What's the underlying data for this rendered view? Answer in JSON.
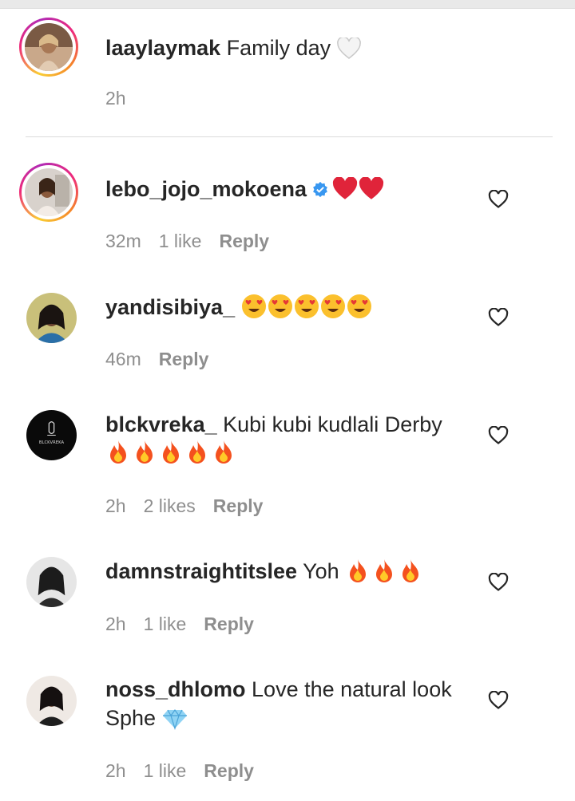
{
  "caption": {
    "username": "laaylaymak",
    "text": "Family day",
    "emoji": "white-heart",
    "time": "2h"
  },
  "comments": [
    {
      "username": "lebo_jojo_mokoena",
      "verified": true,
      "text": "",
      "emoji": [
        "red-heart",
        "red-heart"
      ],
      "time": "32m",
      "likes": "1 like",
      "reply": "Reply"
    },
    {
      "username": "yandisibiya_",
      "text": "",
      "emoji": [
        "heart-eyes",
        "heart-eyes",
        "heart-eyes",
        "heart-eyes",
        "heart-eyes"
      ],
      "time": "46m",
      "likes": "",
      "reply": "Reply"
    },
    {
      "username": "blckvreka_",
      "text": "Kubi kubi kudlali Derby",
      "emoji": [
        "fire",
        "fire",
        "fire",
        "fire",
        "fire"
      ],
      "time": "2h",
      "likes": "2 likes",
      "reply": "Reply",
      "avatar_logo_text": "BLCKVREKA"
    },
    {
      "username": "damnstraightitslee",
      "text": "Yoh",
      "emoji": [
        "fire",
        "fire",
        "fire"
      ],
      "time": "2h",
      "likes": "1 like",
      "reply": "Reply"
    },
    {
      "username": "noss_dhlomo",
      "text": "Love the natural look Sphe",
      "emoji": [
        "gem"
      ],
      "time": "2h",
      "likes": "1 like",
      "reply": "Reply"
    }
  ],
  "colors": {
    "text": "#262626",
    "meta": "#8e8e8e",
    "verified": "#3897f0",
    "divider": "#dbdbdb"
  }
}
